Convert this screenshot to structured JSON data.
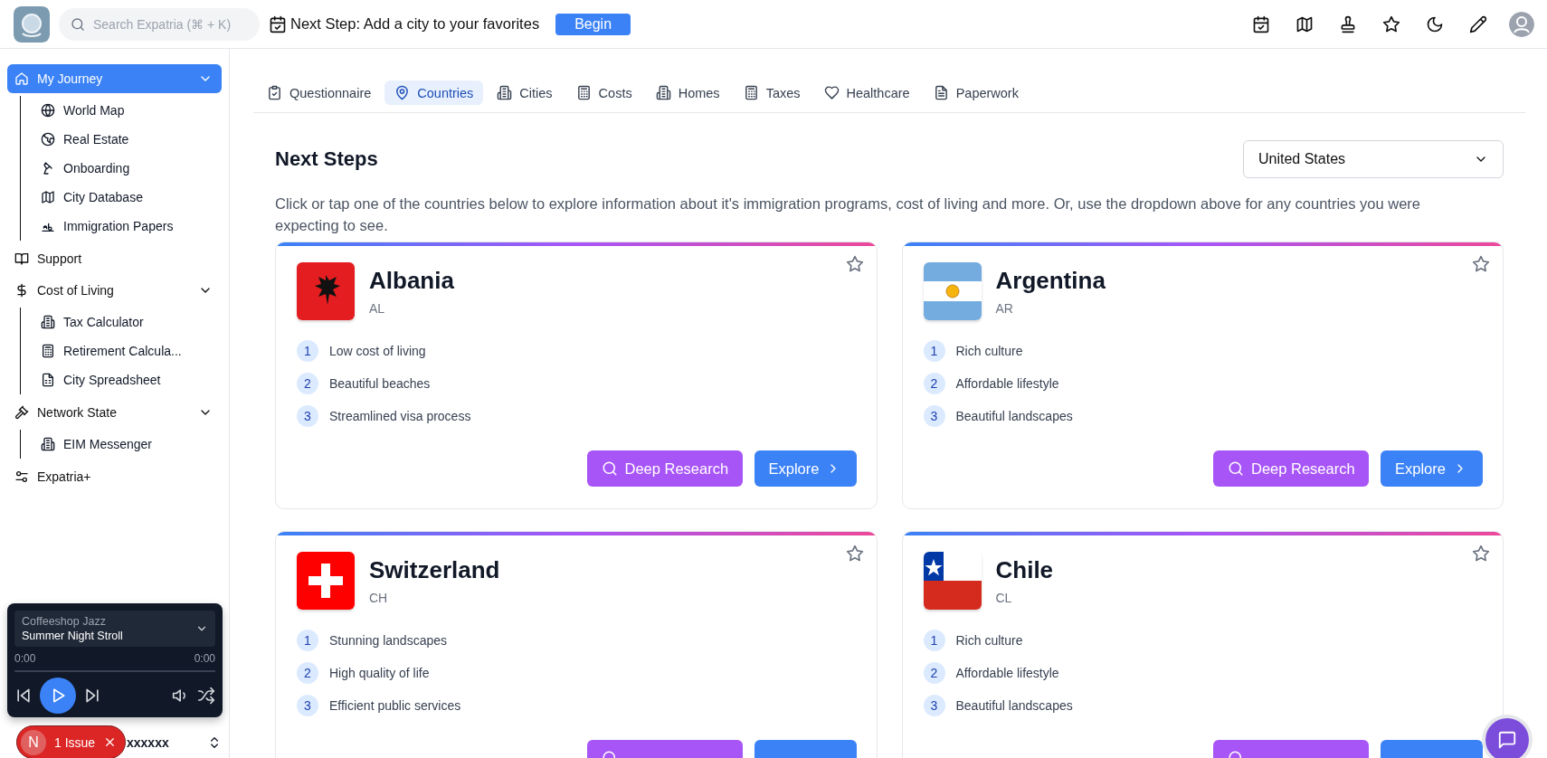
{
  "header": {
    "search": {
      "placeholder": "Search Expatria (⌘ + K)"
    },
    "next_step": "Next Step: Add a city to your favorites",
    "begin_button": "Begin"
  },
  "sidebar": {
    "items": [
      {
        "label": "My Journey",
        "selected": true,
        "expanded": true,
        "children": [
          {
            "label": "World Map",
            "selected": false
          },
          {
            "label": "Real Estate",
            "selected": false
          },
          {
            "label": "Onboarding",
            "selected": false
          },
          {
            "label": "City Database",
            "selected": false
          },
          {
            "label": "Immigration Papers",
            "selected": false
          }
        ]
      },
      {
        "label": "Support",
        "selected": false
      },
      {
        "label": "Cost of Living",
        "selected": false,
        "expanded": true,
        "children": [
          {
            "label": "Tax Calculator",
            "selected": false
          },
          {
            "label": "Retirement Calcula...",
            "selected": false
          },
          {
            "label": "City Spreadsheet",
            "selected": false
          }
        ]
      },
      {
        "label": "Network State",
        "selected": false,
        "expanded": true,
        "children": [
          {
            "label": "EIM Messenger",
            "selected": false
          }
        ]
      },
      {
        "label": "Expatria+",
        "selected": false
      }
    ],
    "user": {
      "name": "xxxxxx"
    }
  },
  "player": {
    "playlist": "Coffeeshop Jazz",
    "track": "Summer Night Stroll",
    "elapsed": "0:00",
    "duration": "0:00"
  },
  "issue_badge": {
    "initial": "N",
    "label": "1 Issue"
  },
  "tabs": [
    {
      "label": "Questionnaire",
      "selected": false
    },
    {
      "label": "Countries",
      "selected": true
    },
    {
      "label": "Cities",
      "selected": false
    },
    {
      "label": "Costs",
      "selected": false
    },
    {
      "label": "Homes",
      "selected": false
    },
    {
      "label": "Taxes",
      "selected": false
    },
    {
      "label": "Healthcare",
      "selected": false
    },
    {
      "label": "Paperwork",
      "selected": false
    }
  ],
  "heading": "Next Steps",
  "country_select": {
    "value": "United States"
  },
  "description": "Click or tap one of the countries below to explore information about it's immigration programs, cost of living and more. Or, use the dropdown above for any countries you were expecting to see.",
  "cards": [
    {
      "name": "Albania",
      "code": "AL",
      "points": [
        {
          "n": "1",
          "text": "Low cost of living"
        },
        {
          "n": "2",
          "text": "Beautiful beaches"
        },
        {
          "n": "3",
          "text": "Streamlined visa process"
        }
      ],
      "actions": [
        {
          "kind": "research",
          "label": "Deep Research"
        },
        {
          "kind": "explore",
          "label": "Explore"
        }
      ]
    },
    {
      "name": "Argentina",
      "code": "AR",
      "points": [
        {
          "n": "1",
          "text": "Rich culture"
        },
        {
          "n": "2",
          "text": "Affordable lifestyle"
        },
        {
          "n": "3",
          "text": "Beautiful landscapes"
        }
      ],
      "actions": [
        {
          "kind": "research",
          "label": "Deep Research"
        },
        {
          "kind": "explore",
          "label": "Explore"
        }
      ]
    },
    {
      "name": "Switzerland",
      "code": "CH",
      "points": [
        {
          "n": "1",
          "text": "Stunning landscapes"
        },
        {
          "n": "2",
          "text": "High quality of life"
        },
        {
          "n": "3",
          "text": "Efficient public services"
        }
      ],
      "actions": [
        {
          "kind": "research"
        },
        {
          "kind": "explore"
        }
      ]
    },
    {
      "name": "Chile",
      "code": "CL",
      "points": [
        {
          "n": "1",
          "text": "Rich culture"
        },
        {
          "n": "2",
          "text": "Affordable lifestyle"
        },
        {
          "n": "3",
          "text": "Beautiful landscapes"
        }
      ],
      "actions": [
        {
          "kind": "research"
        },
        {
          "kind": "explore"
        }
      ]
    }
  ]
}
